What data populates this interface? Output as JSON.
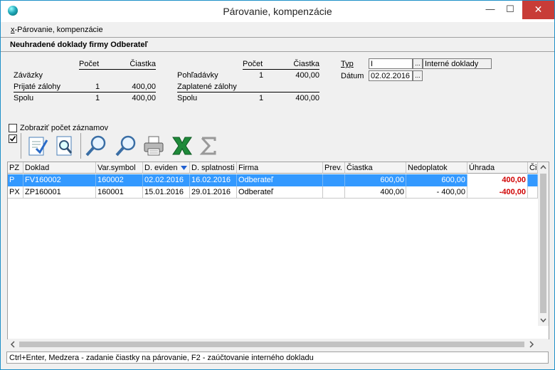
{
  "window": {
    "title": "Párovanie, kompenzácie",
    "min_glyph": "—",
    "max_glyph": "☐",
    "close_glyph": "✕"
  },
  "menu": {
    "accel": "x",
    "label": "-Párovanie, kompenzácie"
  },
  "section": {
    "title": "Neuhradené doklady firmy  Odberateľ"
  },
  "summary_left": {
    "col_pocet": "Počet",
    "col_ciastka": "Čiastka",
    "rows": [
      {
        "label": "Záväzky",
        "pocet": "",
        "ciastka": ""
      },
      {
        "label": "Prijaté zálohy",
        "pocet": "1",
        "ciastka": "400,00"
      },
      {
        "label": "Spolu",
        "pocet": "1",
        "ciastka": "400,00"
      }
    ]
  },
  "summary_right": {
    "col_pocet": "Počet",
    "col_ciastka": "Čiastka",
    "rows": [
      {
        "label": "Pohľadávky",
        "pocet": "1",
        "ciastka": "400,00"
      },
      {
        "label": "Zaplatené zálohy",
        "pocet": "",
        "ciastka": ""
      },
      {
        "label": "Spolu",
        "pocet": "1",
        "ciastka": "400,00"
      }
    ]
  },
  "filters": {
    "typ_label": "Typ",
    "typ_value": "I",
    "typ_desc": "Interné doklady",
    "datum_label": "Dátum",
    "datum_value": "02.02.2016",
    "dots": "..."
  },
  "options": {
    "show_count_label": "Zobraziť počet záznamov",
    "show_count_checked": false,
    "toggle_checked": true
  },
  "toolbar": {
    "icons": [
      "check-document-icon",
      "document-search-icon",
      "zoom-in-icon",
      "search-icon",
      "printer-icon",
      "excel-icon",
      "sum-icon"
    ]
  },
  "grid": {
    "columns": [
      "PZ",
      "Doklad",
      "Var.symbol",
      "D. eviden",
      "D. splatnosti",
      "Firma",
      "Prev.",
      "Čiastka",
      "Nedoplatok",
      "Úhrada",
      "Či"
    ],
    "sorted_column": "D. eviden",
    "rows": [
      {
        "pz": "P",
        "doklad": "FV160002",
        "varsym": "160002",
        "d_eviden": "02.02.2016",
        "d_splat": "16.02.2016",
        "firma": "Odberateľ",
        "prev": "",
        "ciastka": "600,00",
        "nedoplatok": "600,00",
        "uhrada": "400,00",
        "selected": true
      },
      {
        "pz": "PX",
        "doklad": "ZP160001",
        "varsym": "160001",
        "d_eviden": "15.01.2016",
        "d_splat": "29.01.2016",
        "firma": "Odberateľ",
        "prev": "",
        "ciastka": "400,00",
        "nedoplatok": "-  400,00",
        "uhrada": "-400,00",
        "selected": false
      }
    ]
  },
  "status": {
    "text": "Ctrl+Enter, Medzera - zadanie čiastky na párovanie, F2 - zaúčtovanie interného dokladu"
  },
  "colors": {
    "selection": "#3399ff",
    "negative": "#d00000",
    "close_button": "#c83c37",
    "window_border": "#1e90c8"
  }
}
